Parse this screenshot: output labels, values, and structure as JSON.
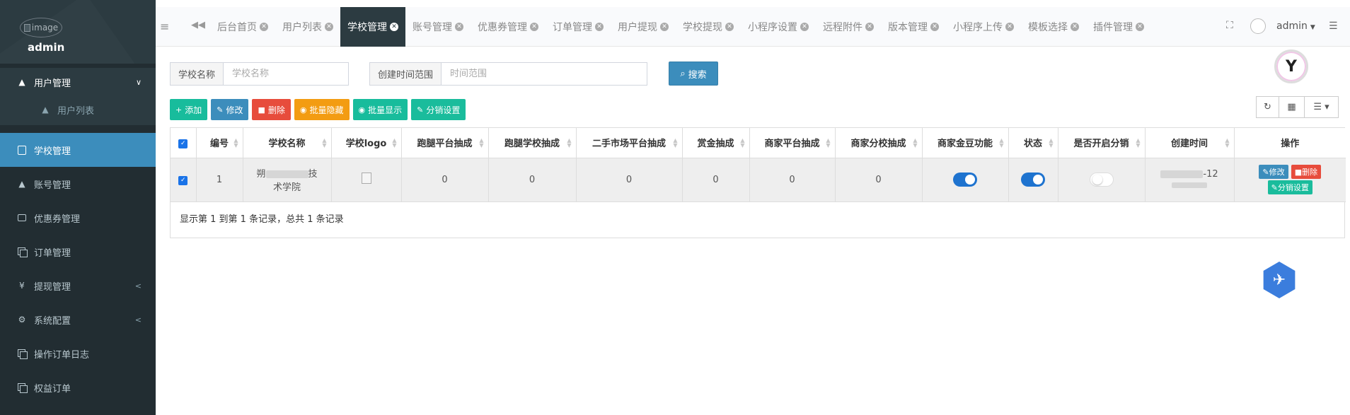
{
  "brand": {
    "img_alt": "image",
    "name": "admin"
  },
  "sidebar": {
    "group": {
      "label": "用户管理",
      "sub": "用户列表"
    },
    "items": [
      {
        "label": "学校管理",
        "icon": "school-icon"
      },
      {
        "label": "账号管理",
        "icon": "users-icon"
      },
      {
        "label": "优惠券管理",
        "icon": "money-icon"
      },
      {
        "label": "订单管理",
        "icon": "copy-icon"
      },
      {
        "label": "提现管理",
        "icon": "yen-icon",
        "glyph": "¥"
      },
      {
        "label": "系统配置",
        "icon": "gear-icon"
      },
      {
        "label": "操作订单日志",
        "icon": "copy-icon"
      },
      {
        "label": "权益订单",
        "icon": "copy-icon"
      }
    ]
  },
  "topbar": {
    "tabs": [
      "后台首页",
      "用户列表",
      "学校管理",
      "账号管理",
      "优惠券管理",
      "订单管理",
      "用户提现",
      "学校提现",
      "小程序设置",
      "远程附件",
      "版本管理",
      "小程序上传",
      "模板选择",
      "插件管理"
    ],
    "active_tab": "学校管理",
    "user": "admin"
  },
  "search": {
    "school_label": "学校名称",
    "school_placeholder": "学校名称",
    "time_label": "创建时间范围",
    "time_placeholder": "时间范围",
    "button": "搜索"
  },
  "toolbar": {
    "add": "添加",
    "edit": "修改",
    "delete": "删除",
    "batch_hide": "批量隐藏",
    "batch_show": "批量显示",
    "distribution": "分销设置"
  },
  "table": {
    "headers": [
      "编号",
      "学校名称",
      "学校logo",
      "跑腿平台抽成",
      "跑腿学校抽成",
      "二手市场平台抽成",
      "赏金抽成",
      "商家平台抽成",
      "商家分校抽成",
      "商家金豆功能",
      "状态",
      "是否开启分销",
      "创建时间",
      "操作"
    ],
    "rows": [
      {
        "id": "1",
        "school_name_a": "朔",
        "school_name_b": "技",
        "school_name_c": "术学院",
        "runner_platform": "0",
        "runner_school": "0",
        "secondhand_platform": "0",
        "bounty": "0",
        "merchant_platform": "0",
        "merchant_branch": "0",
        "gold_bean": true,
        "status": true,
        "distribution": false,
        "created_a": "-12",
        "edit": "修改",
        "delete": "删除",
        "distribution_btn": "分销设置"
      }
    ],
    "pagination": "显示第 1 到第 1 条记录，总共 1 条记录"
  },
  "colors": {
    "sidebar_bg": "#222d32",
    "active": "#3c8dbc",
    "toggle_on": "#1e73cf"
  }
}
